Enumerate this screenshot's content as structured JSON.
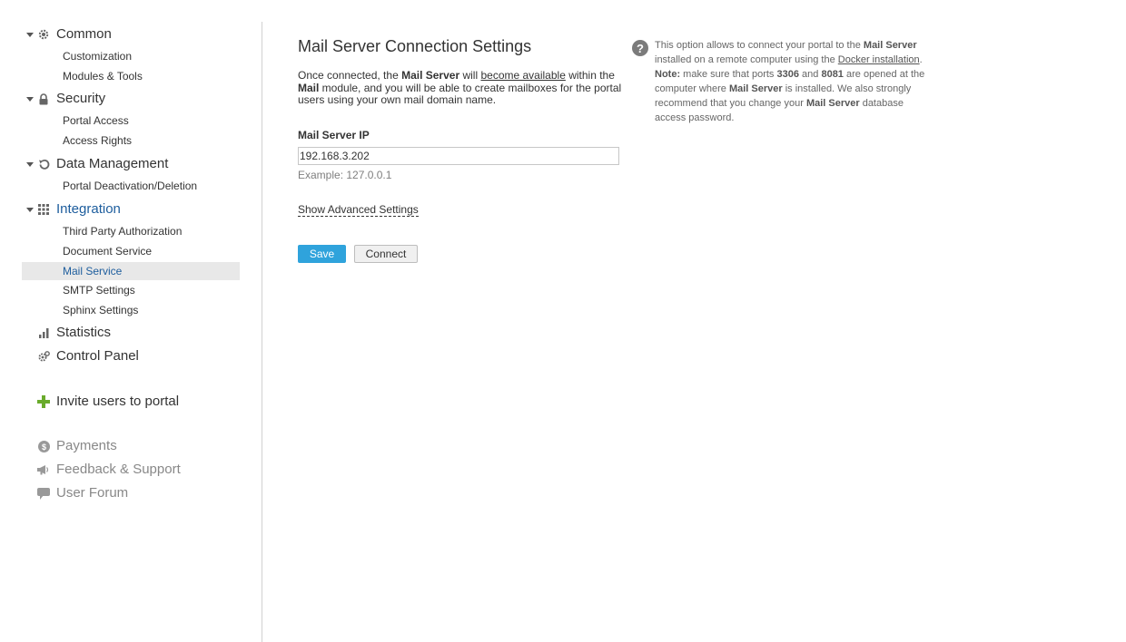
{
  "sidebar": {
    "sections": [
      {
        "label": "Common",
        "icon": "gear-icon",
        "items": [
          "Customization",
          "Modules & Tools"
        ]
      },
      {
        "label": "Security",
        "icon": "lock-icon",
        "items": [
          "Portal Access",
          "Access Rights"
        ]
      },
      {
        "label": "Data Management",
        "icon": "restore-icon",
        "items": [
          "Portal Deactivation/Deletion"
        ]
      },
      {
        "label": "Integration",
        "icon": "grid-icon",
        "items": [
          "Third Party Authorization",
          "Document Service",
          "Mail Service",
          "SMTP Settings",
          "Sphinx Settings"
        ]
      }
    ],
    "statistics": "Statistics",
    "control_panel": "Control Panel",
    "invite": "Invite users to portal",
    "payments": "Payments",
    "feedback": "Feedback & Support",
    "forum": "User Forum",
    "selected_item": "Mail Service"
  },
  "main": {
    "title": "Mail Server Connection Settings",
    "desc": {
      "p1": "Once connected, the ",
      "b1": "Mail Server",
      "p2": " will ",
      "u1": "become available",
      "p3": " within the ",
      "b2": "Mail",
      "p4": " module, and you will be able to create mailboxes for the portal users using your own mail domain name."
    },
    "ip_label": "Mail Server IP",
    "ip_value": "192.168.3.202",
    "example": "Example: 127.0.0.1",
    "advanced_link": "Show Advanced Settings",
    "save_label": "Save",
    "connect_label": "Connect"
  },
  "help": {
    "t1": "This option allows to connect your portal to the ",
    "b1": "Mail Server",
    "t2": " installed on a remote computer using the ",
    "u1": "Docker installation",
    "t3": ". ",
    "b2": "Note:",
    "t4": " make sure that ports ",
    "b3": "3306",
    "t5": " and ",
    "b4": "8081",
    "t6": " are opened at the computer where ",
    "b5": "Mail Server",
    "t7": " is installed. We also strongly recommend that you change your ",
    "b6": "Mail Server",
    "t8": " database access password."
  },
  "colors": {
    "accent": "#2fa3dc",
    "link_active": "#1d5d9d",
    "selected_bg": "#e8e8e8"
  }
}
